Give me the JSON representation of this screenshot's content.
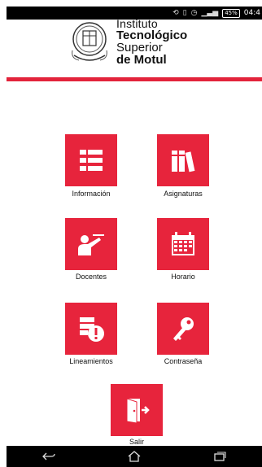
{
  "status_bar": {
    "time": "04:4",
    "battery": "45%",
    "icons": [
      "sync-icon",
      "vibrate-icon",
      "alarm-icon",
      "signal-icon",
      "battery-icon"
    ]
  },
  "header": {
    "line1": "Instituto",
    "line2": "Tecnológico",
    "line3": "Superior",
    "line4": "de Motul",
    "seal": "institute-seal-icon"
  },
  "colors": {
    "accent": "#e7243c",
    "background": "#ffffff",
    "text": "#111111"
  },
  "menu": [
    {
      "label": "Información",
      "icon": "list-icon"
    },
    {
      "label": "Asignaturas",
      "icon": "books-icon"
    },
    {
      "label": "Docentes",
      "icon": "teacher-icon"
    },
    {
      "label": "Horario",
      "icon": "calendar-icon"
    },
    {
      "label": "Lineamientos",
      "icon": "guidelines-alert-icon"
    },
    {
      "label": "Contraseña",
      "icon": "key-icon"
    },
    {
      "label": "Salir",
      "icon": "exit-door-icon"
    }
  ],
  "navigation": [
    "back-icon",
    "home-icon",
    "recent-apps-icon"
  ]
}
